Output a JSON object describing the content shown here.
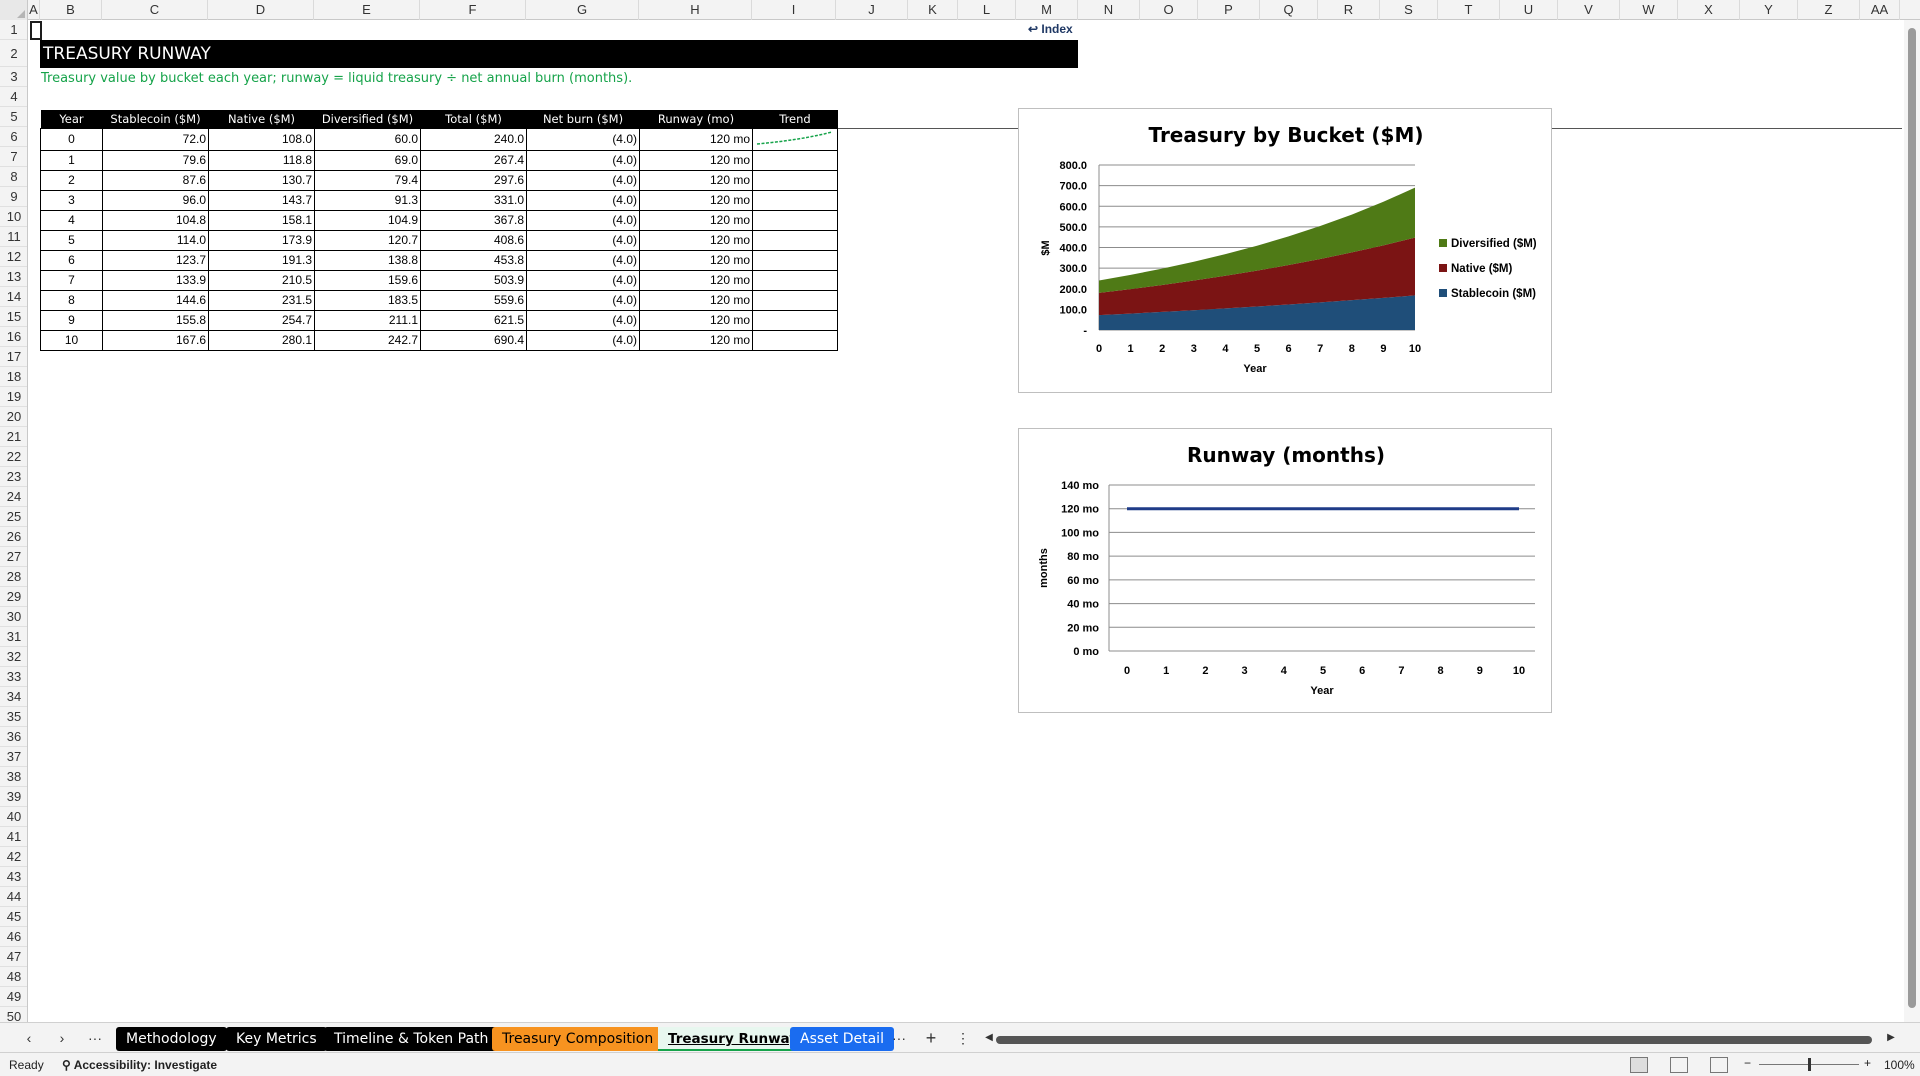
{
  "columns": [
    "A",
    "B",
    "C",
    "D",
    "E",
    "F",
    "G",
    "H",
    "I",
    "J",
    "K",
    "L",
    "M",
    "N",
    "O",
    "P",
    "Q",
    "R",
    "S",
    "T",
    "U",
    "V",
    "W",
    "X",
    "Y",
    "Z",
    "AA"
  ],
  "rows": [
    "1",
    "2",
    "3",
    "4",
    "5",
    "6",
    "7",
    "8",
    "9",
    "10",
    "11",
    "12",
    "13",
    "14",
    "15",
    "16",
    "17",
    "18",
    "19",
    "20",
    "21",
    "22",
    "23",
    "24",
    "25",
    "26",
    "27",
    "28",
    "29",
    "30",
    "31",
    "32",
    "33",
    "34",
    "35",
    "36",
    "37",
    "38",
    "39",
    "40",
    "41",
    "42",
    "43",
    "44",
    "45",
    "46",
    "47",
    "48",
    "49",
    "50"
  ],
  "sheet": {
    "index_link": "↩ Index",
    "title": "TREASURY RUNWAY",
    "subtitle": "Treasury value by bucket each year; runway = liquid treasury ÷ net annual burn (months).",
    "table": {
      "headers": [
        "Year",
        "Stablecoin ($M)",
        "Native ($M)",
        "Diversified ($M)",
        "Total ($M)",
        "Net burn ($M)",
        "Runway (mo)",
        "Trend"
      ],
      "rows": [
        [
          "0",
          "72.0",
          "108.0",
          "60.0",
          "240.0",
          "(4.0)",
          "120 mo"
        ],
        [
          "1",
          "79.6",
          "118.8",
          "69.0",
          "267.4",
          "(4.0)",
          "120 mo"
        ],
        [
          "2",
          "87.6",
          "130.7",
          "79.4",
          "297.6",
          "(4.0)",
          "120 mo"
        ],
        [
          "3",
          "96.0",
          "143.7",
          "91.3",
          "331.0",
          "(4.0)",
          "120 mo"
        ],
        [
          "4",
          "104.8",
          "158.1",
          "104.9",
          "367.8",
          "(4.0)",
          "120 mo"
        ],
        [
          "5",
          "114.0",
          "173.9",
          "120.7",
          "408.6",
          "(4.0)",
          "120 mo"
        ],
        [
          "6",
          "123.7",
          "191.3",
          "138.8",
          "453.8",
          "(4.0)",
          "120 mo"
        ],
        [
          "7",
          "133.9",
          "210.5",
          "159.6",
          "503.9",
          "(4.0)",
          "120 mo"
        ],
        [
          "8",
          "144.6",
          "231.5",
          "183.5",
          "559.6",
          "(4.0)",
          "120 mo"
        ],
        [
          "9",
          "155.8",
          "254.7",
          "211.1",
          "621.5",
          "(4.0)",
          "120 mo"
        ],
        [
          "10",
          "167.6",
          "280.1",
          "242.7",
          "690.4",
          "(4.0)",
          "120 mo"
        ]
      ]
    }
  },
  "chart_data": [
    {
      "type": "area",
      "stacked": true,
      "title": "Treasury by Bucket ($M)",
      "xlabel": "Year",
      "ylabel": "$M",
      "x": [
        0,
        1,
        2,
        3,
        4,
        5,
        6,
        7,
        8,
        9,
        10
      ],
      "ylim": [
        0,
        800
      ],
      "y_ticks": [
        "-",
        "100.0",
        "200.0",
        "300.0",
        "400.0",
        "500.0",
        "600.0",
        "700.0",
        "800.0"
      ],
      "grid": true,
      "legend": "right",
      "series": [
        {
          "name": "Stablecoin ($M)",
          "color": "#1f4e79",
          "values": [
            72.0,
            79.6,
            87.6,
            96.0,
            104.8,
            114.0,
            123.7,
            133.9,
            144.6,
            155.8,
            167.6
          ]
        },
        {
          "name": "Native ($M)",
          "color": "#7b1414",
          "values": [
            108.0,
            118.8,
            130.7,
            143.7,
            158.1,
            173.9,
            191.3,
            210.5,
            231.5,
            254.7,
            280.1
          ]
        },
        {
          "name": "Diversified ($M)",
          "color": "#4f7a16",
          "values": [
            60.0,
            69.0,
            79.4,
            91.3,
            104.9,
            120.7,
            138.8,
            159.6,
            183.5,
            211.1,
            242.7
          ]
        }
      ]
    },
    {
      "type": "line",
      "title": "Runway (months)",
      "xlabel": "Year",
      "ylabel": "months",
      "x": [
        0,
        1,
        2,
        3,
        4,
        5,
        6,
        7,
        8,
        9,
        10
      ],
      "ylim": [
        0,
        140
      ],
      "y_ticks": [
        "0 mo",
        "20 mo",
        "40 mo",
        "60 mo",
        "80 mo",
        "100 mo",
        "120 mo",
        "140 mo"
      ],
      "grid": true,
      "series": [
        {
          "color": "#1f3c88",
          "values": [
            120,
            120,
            120,
            120,
            120,
            120,
            120,
            120,
            120,
            120,
            120
          ]
        }
      ]
    }
  ],
  "sparkline": {
    "color": "#16a34a",
    "values": [
      240.0,
      267.4,
      297.6,
      331.0,
      367.8,
      408.6,
      453.8,
      503.9,
      559.6,
      621.5,
      690.4
    ]
  },
  "tabs": [
    {
      "label": "Methodology",
      "style": "dark"
    },
    {
      "label": "Key Metrics",
      "style": "dark"
    },
    {
      "label": "Timeline & Token Path",
      "style": "dark"
    },
    {
      "label": "Treasury Composition",
      "style": "orange"
    },
    {
      "label": "Treasury Runway",
      "style": "active"
    },
    {
      "label": "Asset Detail",
      "style": "blue"
    }
  ],
  "status": {
    "ready": "Ready",
    "accessibility": "Accessibility: Investigate",
    "zoom": "100%"
  }
}
